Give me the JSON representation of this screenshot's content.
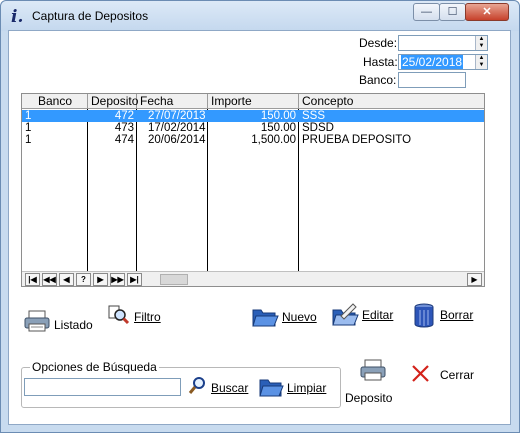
{
  "window": {
    "title": "Captura de Depositos",
    "buttons": {
      "minimize": "—",
      "maximize": "☐",
      "close": "✕"
    }
  },
  "filters": {
    "desde_label": "Desde:",
    "desde_value": "",
    "hasta_label": "Hasta:",
    "hasta_value": "25/02/2018",
    "banco_label": "Banco:",
    "banco_value": ""
  },
  "grid": {
    "columns": [
      "Banco",
      "Deposito",
      "Fecha",
      "Importe",
      "Concepto"
    ],
    "rows": [
      {
        "banco": "1",
        "deposito": "472",
        "fecha": "27/07/2013",
        "importe": "150.00",
        "concepto": "SSS",
        "selected": true
      },
      {
        "banco": "1",
        "deposito": "473",
        "fecha": "17/02/2014",
        "importe": "150.00",
        "concepto": "SDSD",
        "selected": false
      },
      {
        "banco": "1",
        "deposito": "474",
        "fecha": "20/06/2014",
        "importe": "1,500.00",
        "concepto": "PRUEBA DEPOSITO",
        "selected": false
      }
    ],
    "nav_buttons": [
      "|◀",
      "◀◀",
      "◀",
      "?",
      "▶",
      "▶▶",
      "▶|"
    ],
    "scroll_right": "▶"
  },
  "actions": {
    "listado": "Listado",
    "filtro": "Filtro",
    "nuevo": "Nuevo",
    "editar": "Editar",
    "borrar": "Borrar",
    "deposito": "Deposito",
    "cerrar": "Cerrar"
  },
  "search": {
    "group_title": "Opciones de Búsqueda",
    "value": "",
    "buscar": "Buscar",
    "limpiar": "Limpiar"
  },
  "colors": {
    "selection": "#3399ff",
    "window_frame": "#c8dbef",
    "close_red": "#c7412b"
  }
}
